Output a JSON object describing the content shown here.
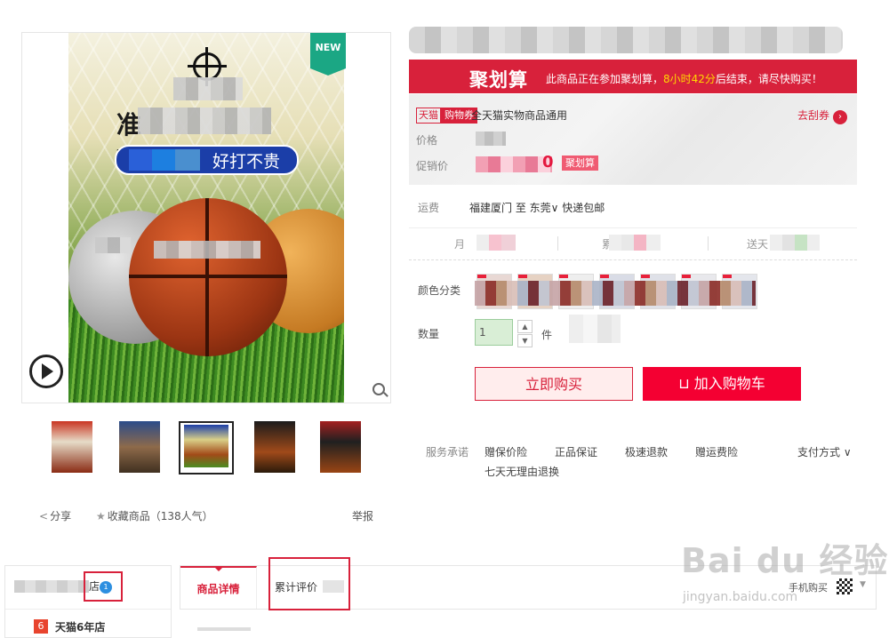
{
  "gallery": {
    "new_badge": "NEW",
    "headline_tail": "球",
    "headline_head": "准",
    "pill_text": "好打不贵"
  },
  "actions": {
    "share": "分享",
    "favorite": "收藏商品（138人气）",
    "report": "举报"
  },
  "promo": {
    "logo": "聚划算",
    "text_before": "此商品正在参加聚划算，",
    "time": "8小时42分",
    "text_after": "后结束，请尽快购买！"
  },
  "price_box": {
    "tag_a": "天猫",
    "tag_b": "购物券",
    "coupon_text": "全天猫实物商品通用",
    "coupon_link": "去刮券",
    "price_label": "价格",
    "promo_label": "促销价",
    "promo_digit": "0",
    "promo_tag": "聚划算"
  },
  "shipping": {
    "label": "运费",
    "value": "福建厦门 至 东莞∨ 快递包邮"
  },
  "stats": [
    "月",
    "累",
    "送天"
  ],
  "sku": {
    "color_label": "颜色分类",
    "qty_label": "数量",
    "qty_value": "1",
    "qty_unit": "件"
  },
  "buttons": {
    "buy_now": "立即购买",
    "add_cart": "⊔ 加入购物车"
  },
  "service": {
    "label": "服务承诺",
    "items": [
      "赠保价险",
      "正品保证",
      "极速退款",
      "赠运费险"
    ],
    "item2": "七天无理由退换",
    "pay": "支付方式 ∨"
  },
  "shop": {
    "name_suffix": "店",
    "badge": "1",
    "years_num": "6",
    "years": "天猫6年店"
  },
  "tabs": {
    "detail": "商品详情",
    "review": "累计评价",
    "mobile": "手机购买"
  },
  "watermark": {
    "main": "Bai  du 经验",
    "sub": "jingyan.baidu.com"
  },
  "colors": {
    "brand_red": "#d8213b",
    "cart_red": "#f40032",
    "new_green": "#1ba784",
    "highlight_red": "#d8213b"
  }
}
